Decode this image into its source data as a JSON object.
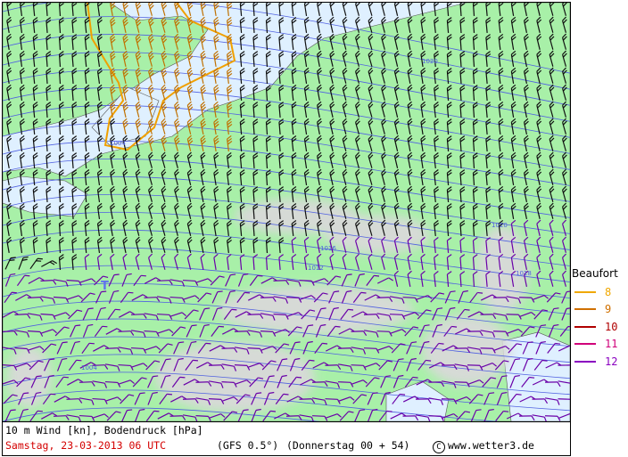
{
  "legend": {
    "title": "Beaufort",
    "items": [
      {
        "value": "8",
        "color": "#f0a800"
      },
      {
        "value": "9",
        "color": "#d07000"
      },
      {
        "value": "10",
        "color": "#b00000"
      },
      {
        "value": "11",
        "color": "#d0007a"
      },
      {
        "value": "12",
        "color": "#8a00c0"
      }
    ]
  },
  "footer": {
    "title": "10 m Wind [kn], Bodendruck [hPa]",
    "date": "Samstag, 23-03-2013  06 UTC",
    "model": "(GFS 0.5°)",
    "run": "(Donnerstag 00 + 54)",
    "copyright_symbol": "C",
    "site": "www.wetter3.de"
  },
  "map": {
    "isobar_labels": [
      "1020",
      "1020",
      "1016",
      "1012",
      "1018",
      "1004",
      "1004"
    ],
    "low_marker": "T",
    "colors": {
      "sea": "#dff0ff",
      "land": "#a8f0a8",
      "mountain": "#d8d8d8",
      "isobar": "#5060e0",
      "gale_contour": "#f0a000"
    }
  }
}
